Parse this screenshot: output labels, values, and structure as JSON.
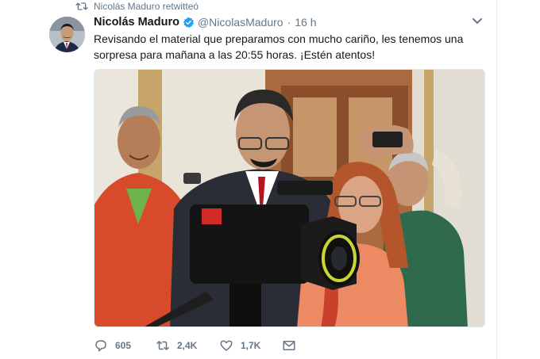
{
  "retweet_notice": {
    "icon": "retweet-icon",
    "text": "Nicolás Maduro retwitteó"
  },
  "tweet": {
    "avatar_icon": "avatar-photo",
    "display_name": "Nicolás Maduro",
    "verified_icon": "verified-badge-icon",
    "handle": "@NicolasMaduro",
    "separator": "·",
    "time": "16 h",
    "menu_icon": "chevron-down-icon",
    "text": "Revisando el material que preparamos con mucho cariño, les tenemos una sorpresa para mañana a las 20:55 horas. ¡Estén atentos!",
    "media_icon": "photo-camera-crew"
  },
  "actions": {
    "reply": {
      "icon": "reply-icon",
      "count": "605"
    },
    "retweet": {
      "icon": "retweet-icon",
      "count": "2,4K"
    },
    "like": {
      "icon": "heart-icon",
      "count": "1,7K"
    },
    "dm": {
      "icon": "envelope-icon"
    }
  },
  "colors": {
    "accent": "#1da1f2",
    "secondary_text": "#657786",
    "primary_text": "#14171a"
  }
}
